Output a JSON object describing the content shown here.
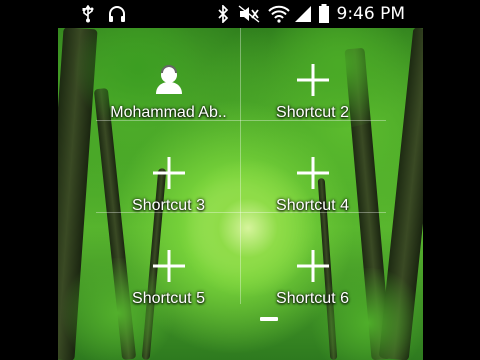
{
  "status_bar": {
    "time": "9:46 PM",
    "icons": [
      "usb-icon",
      "headphones-icon",
      "bluetooth-icon",
      "mute-icon",
      "wifi-icon",
      "signal-icon",
      "battery-icon"
    ]
  },
  "widget": {
    "shortcuts": [
      {
        "label": "Mohammad Ab..",
        "icon": "contact-icon"
      },
      {
        "label": "Shortcut 2",
        "icon": "plus-icon"
      },
      {
        "label": "Shortcut 3",
        "icon": "plus-icon"
      },
      {
        "label": "Shortcut 4",
        "icon": "plus-icon"
      },
      {
        "label": "Shortcut 5",
        "icon": "plus-icon"
      },
      {
        "label": "Shortcut 6",
        "icon": "plus-icon"
      }
    ]
  },
  "colors": {
    "label": "#ffffff",
    "status_bg": "#000000",
    "accent": "#ffffff"
  }
}
